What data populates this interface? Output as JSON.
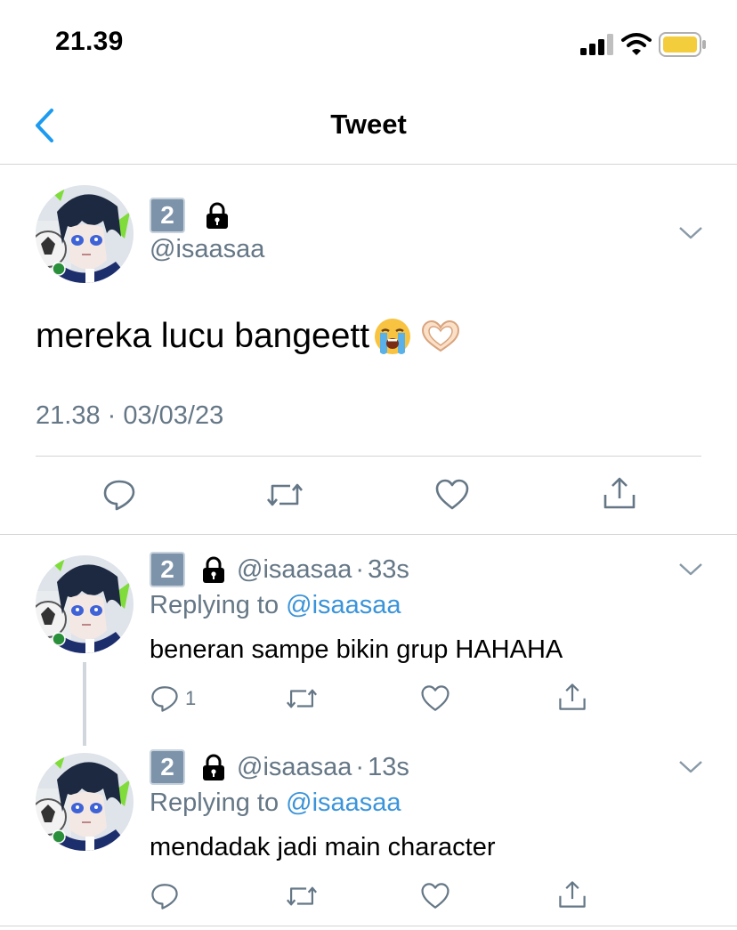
{
  "status_bar": {
    "time": "21.39",
    "battery_color": "#f4cd3c"
  },
  "nav": {
    "title": "Tweet",
    "accent_color": "#1d9bf0"
  },
  "main_tweet": {
    "badge": "2",
    "handle": "@isaasaa",
    "text": "mereka lucu bangeett",
    "emojis": [
      "loudly-crying-face",
      "heart-hands"
    ],
    "timestamp": "21.38 · 03/03/23",
    "actions": [
      "reply-icon",
      "retweet-icon",
      "like-icon",
      "share-icon"
    ]
  },
  "replies": [
    {
      "badge": "2",
      "handle": "@isaasaa",
      "separator": "·",
      "time": "33s",
      "replying_prefix": "Replying to",
      "replying_to": "@isaasaa",
      "text": "beneran sampe bikin grup HAHAHA",
      "reply_count": "1"
    },
    {
      "badge": "2",
      "handle": "@isaasaa",
      "separator": "·",
      "time": "13s",
      "replying_prefix": "Replying to",
      "replying_to": "@isaasaa",
      "text": "mendadak jadi main character",
      "reply_count": ""
    }
  ]
}
